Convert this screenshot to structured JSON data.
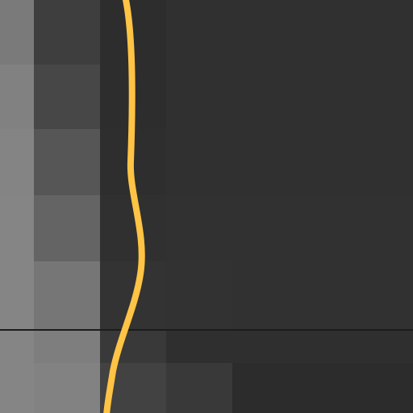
{
  "viewport": {
    "background": "#303030"
  },
  "tiles": {
    "columns": 7,
    "rows": 7,
    "colors": [
      [
        "#7a7a7a",
        "#3e3e3e",
        "#2d2d2d",
        "#303030",
        "#303030",
        "#303030",
        "#303030"
      ],
      [
        "#818181",
        "#474747",
        "#2d2d2d",
        "#303030",
        "#303030",
        "#303030",
        "#303030"
      ],
      [
        "#848484",
        "#565656",
        "#2e2e2e",
        "#303030",
        "#303030",
        "#303030",
        "#303030"
      ],
      [
        "#858585",
        "#646464",
        "#303030",
        "#313131",
        "#313131",
        "#313131",
        "#313131"
      ],
      [
        "#858585",
        "#767676",
        "#333333",
        "#323232",
        "#313131",
        "#313131",
        "#313131"
      ],
      [
        "#858585",
        "#7e7e7e",
        "#393939",
        "#2f2f2f",
        "#2f2f2f",
        "#2f2f2f",
        "#2f2f2f"
      ],
      [
        "#858585",
        "#828282",
        "#424242",
        "#393939",
        "#2c2c2c",
        "#2c2c2c",
        "#2c2c2c"
      ]
    ]
  },
  "horizon": {
    "color": "#1c1c1c"
  },
  "curve": {
    "color": "#ffc445"
  }
}
